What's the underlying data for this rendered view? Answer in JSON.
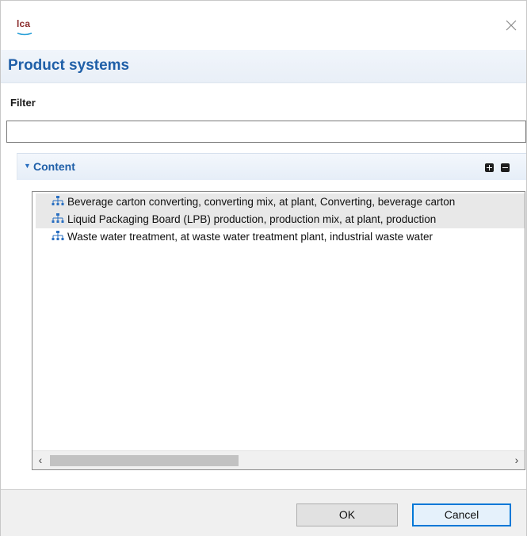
{
  "app": {
    "logo_text": "LCA",
    "colors": {
      "accent": "#1f5fa8",
      "logo": "#8a2b2b",
      "logo_underline": "#2aa0d8"
    }
  },
  "window": {
    "close_icon": "close-icon"
  },
  "header": {
    "title": "Product systems"
  },
  "filter": {
    "label": "Filter",
    "value": "",
    "placeholder": ""
  },
  "section": {
    "title": "Content",
    "expanded": true,
    "expand_all_icon": "plus-square-icon",
    "collapse_all_icon": "minus-square-icon"
  },
  "tree": {
    "items": [
      {
        "label": "Beverage carton converting, converting mix, at plant, Converting, beverage carton",
        "icon": "product-system-icon",
        "selected": true
      },
      {
        "label": "Liquid Packaging Board (LPB) production, production mix, at plant, production",
        "icon": "product-system-icon",
        "selected": true
      },
      {
        "label": "Waste water treatment, at waste water treatment plant, industrial waste water",
        "icon": "product-system-icon",
        "selected": false
      }
    ],
    "scrollbar": {
      "left_icon": "chevron-left-icon",
      "right_icon": "chevron-right-icon",
      "position": 0
    }
  },
  "footer": {
    "ok_label": "OK",
    "cancel_label": "Cancel"
  }
}
